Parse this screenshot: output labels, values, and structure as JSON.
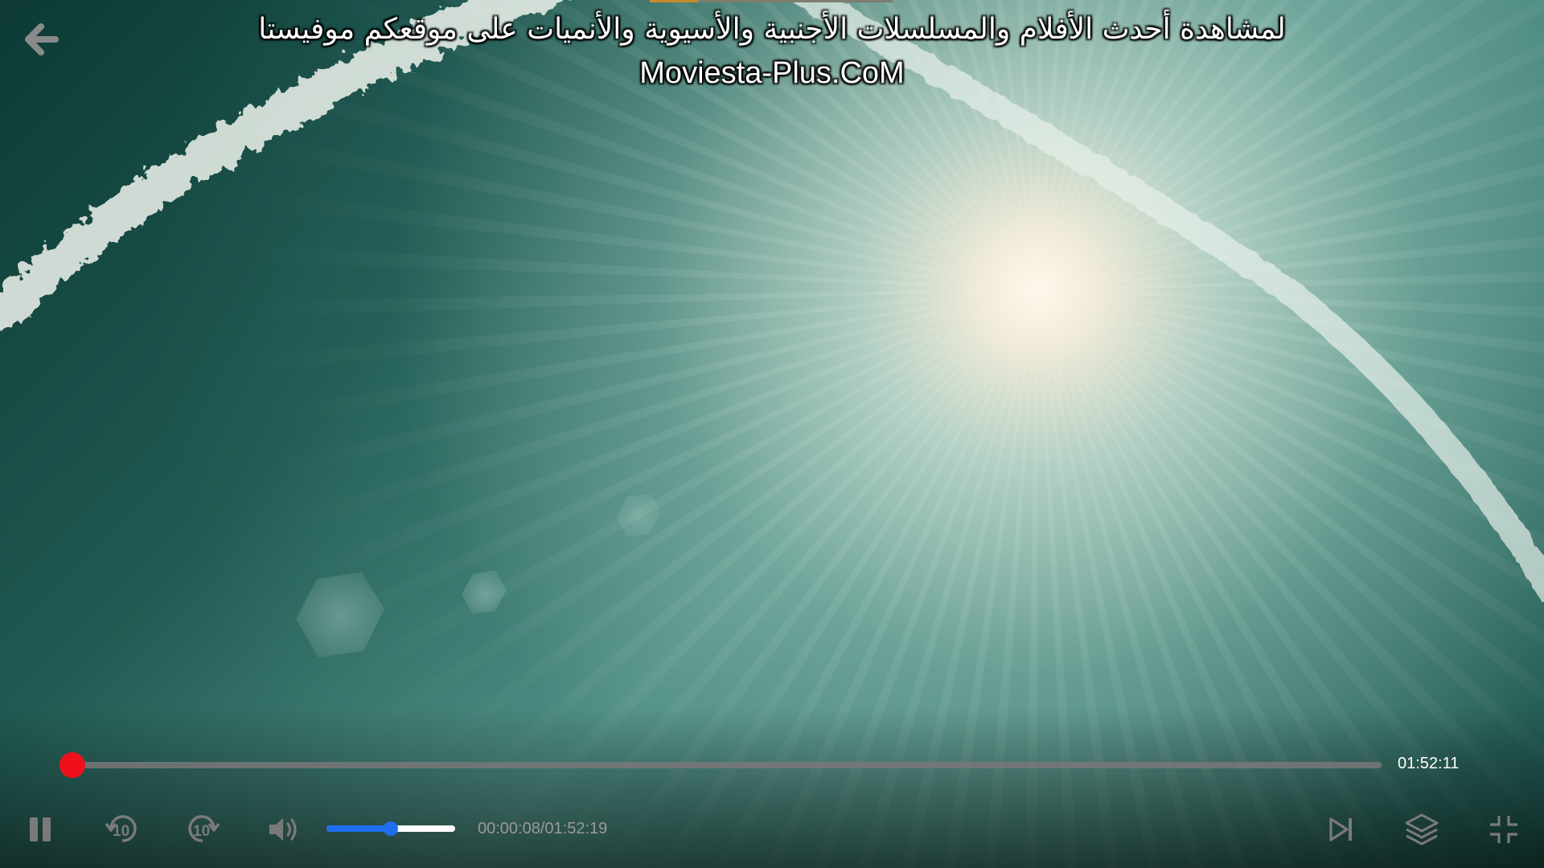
{
  "video": {
    "subtitle_line1": "لمشاهدة أحدث الأفلام والمسلسلات الأجنبية والأسيوية والأنميات على موقعكم موفيستا",
    "subtitle_line2": "Moviesta-Plus.CoM"
  },
  "progress": {
    "played_fraction": 0.0012,
    "remaining_label": "01:52:11"
  },
  "controls": {
    "back_icon": "arrow-left-icon",
    "pause_icon": "pause-icon",
    "rewind_icon": "rewind-10-icon",
    "rewind_seconds": "10",
    "forward_icon": "forward-10-icon",
    "forward_seconds": "10",
    "volume_icon": "volume-up-icon",
    "volume_level": 0.5,
    "time_label": "00:00:08/01:52:19",
    "next_icon": "skip-next-icon",
    "tracks_icon": "layers-icon",
    "fullscreen_icon": "exit-fullscreen-icon"
  },
  "colors": {
    "progress_accent": "#e0141e",
    "volume_accent": "#1e6ff0"
  }
}
